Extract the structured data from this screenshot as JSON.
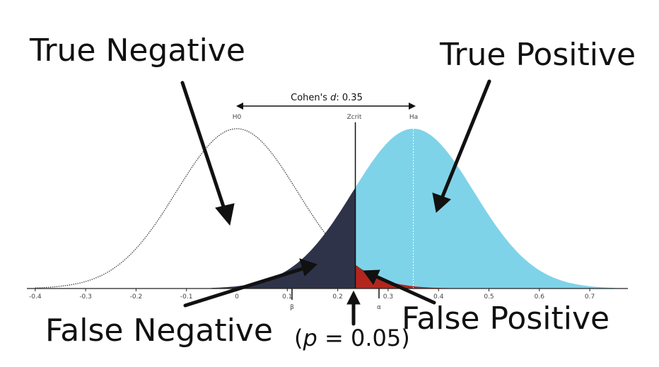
{
  "labels": {
    "true_negative": "True Negative",
    "true_positive": "True Positive",
    "false_negative": "False Negative",
    "false_positive": "False Positive",
    "p_prefix": "(",
    "p_symbol": "p",
    "p_suffix": " = 0.05)"
  },
  "effect": {
    "prefix": "Cohen's ",
    "symbol": "d",
    "suffix": ": 0.35"
  },
  "markers": {
    "h0": "H0",
    "zcrit": "Zcrit",
    "ha": "Ha",
    "beta": "β",
    "alpha": "α"
  },
  "axis": {
    "ticks": [
      -0.4,
      -0.3,
      -0.2,
      -0.1,
      0.0,
      0.1,
      0.2,
      0.3,
      0.4,
      0.5,
      0.6,
      0.7
    ],
    "tick_labels": [
      "-0.4",
      "-0.3",
      "-0.2",
      "-0.1",
      "0",
      "0.1",
      "0.2",
      "0.3",
      "0.4",
      "0.5",
      "0.6",
      "0.7"
    ]
  },
  "distribution": {
    "h0_mean": 0,
    "ha_mean": 0.35,
    "zcrit": 0.235,
    "sd": 0.12
  },
  "colors": {
    "true_positive_fill": "#7fd3e8",
    "false_negative_fill": "#2e3349",
    "false_positive_fill": "#b3261e",
    "h0_curve": "#333333"
  }
}
